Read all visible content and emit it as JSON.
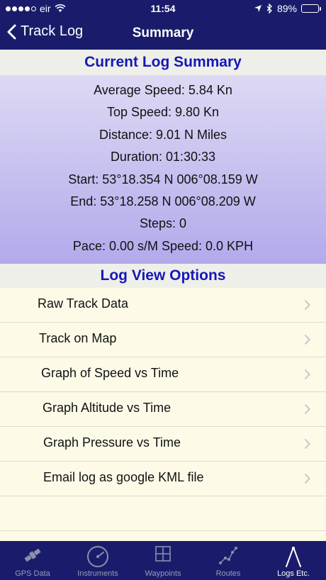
{
  "status_bar": {
    "carrier": "eir",
    "time": "11:54",
    "battery_text": "89%",
    "battery_level": 0.89
  },
  "nav": {
    "back_label": "Track Log",
    "title": "Summary"
  },
  "summary": {
    "header": "Current Log Summary",
    "lines": [
      "Average Speed: 5.84 Kn",
      "Top Speed: 9.80 Kn",
      "Distance: 9.01 N Miles",
      "Duration: 01:30:33",
      "Start: 53°18.354 N  006°08.159 W",
      "End: 53°18.258 N  006°08.209 W",
      "Steps: 0",
      "Pace: 0.00 s/M Speed: 0.0 KPH"
    ]
  },
  "options": {
    "header": "Log View Options",
    "items": [
      "Raw Track Data",
      "Track on Map",
      "Graph of Speed vs Time",
      "Graph Altitude vs Time",
      "Graph Pressure vs Time",
      "Email log as google KML file"
    ]
  },
  "tabs": [
    {
      "label": "GPS Data",
      "icon": "satellite-icon"
    },
    {
      "label": "Instruments",
      "icon": "gauge-icon"
    },
    {
      "label": "Waypoints",
      "icon": "grid-icon"
    },
    {
      "label": "Routes",
      "icon": "route-icon"
    },
    {
      "label": "Logs Etc.",
      "icon": "compass-icon"
    }
  ],
  "colors": {
    "bar_background": "#1a1c6b",
    "header_text": "#1518b8",
    "summary_gradient_top": "#ddd9f4",
    "summary_gradient_bottom": "#b2aaeb",
    "list_background": "#fdfbe8"
  }
}
